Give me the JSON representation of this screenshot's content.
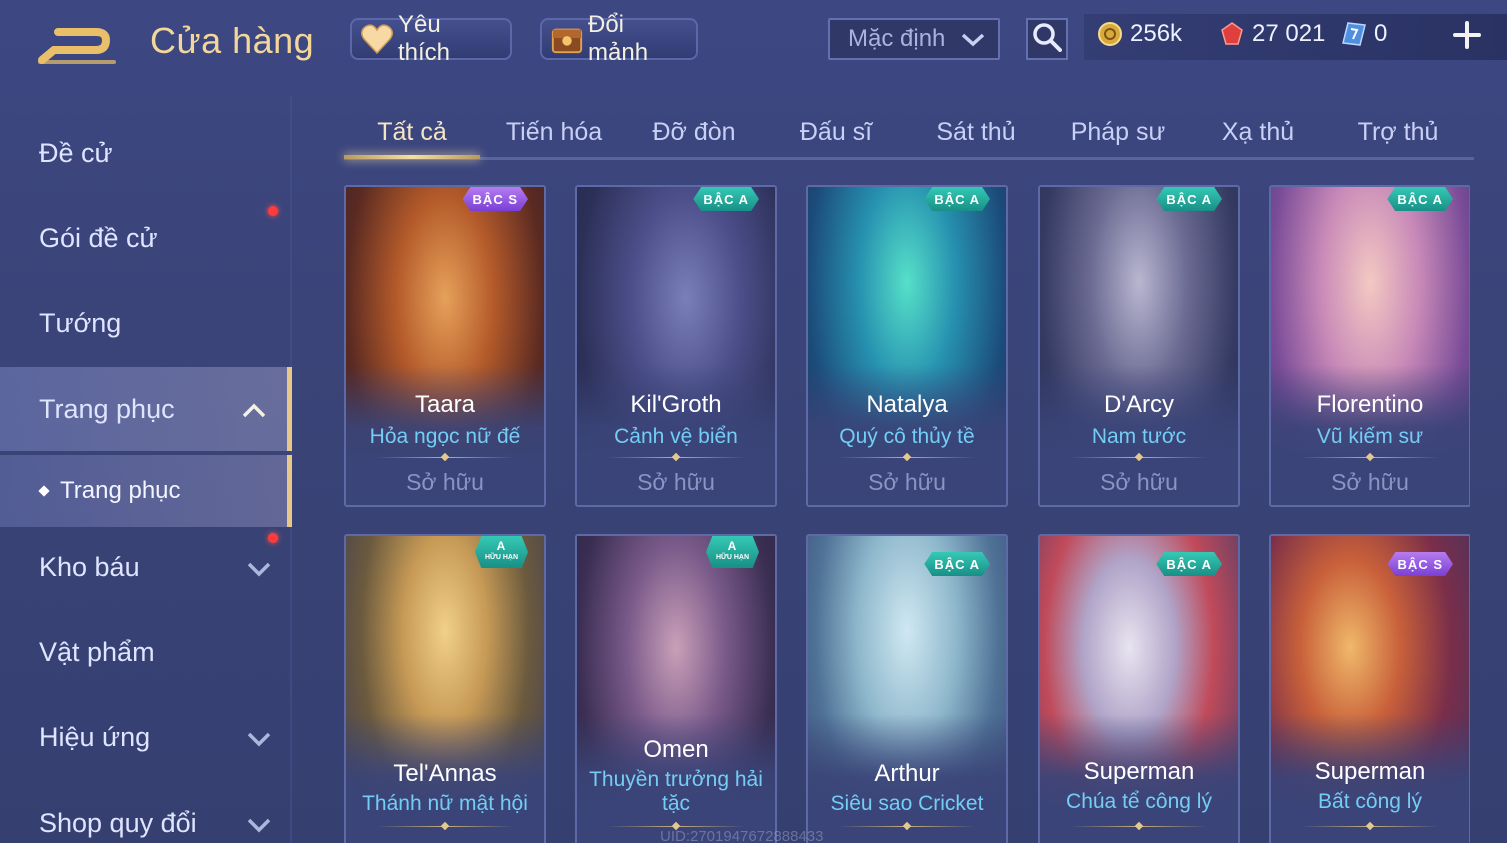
{
  "header": {
    "title": "Cửa hàng",
    "favorites_label": "Yêu thích",
    "shard_exchange_label": "Đổi mảnh",
    "sort_value": "Mặc định"
  },
  "currencies": [
    {
      "icon": "gold-coin-icon",
      "value": "256k"
    },
    {
      "icon": "ruby-gem-icon",
      "value": "27 021"
    },
    {
      "icon": "voucher-icon",
      "value": "0"
    }
  ],
  "sidebar": {
    "items": [
      {
        "label": "Đề cử"
      },
      {
        "label": "Gói đề cử"
      },
      {
        "label": "Tướng"
      },
      {
        "label": "Trang phục"
      },
      {
        "label": "Trang phục"
      },
      {
        "label": "Kho báu"
      },
      {
        "label": "Vật phẩm"
      },
      {
        "label": "Hiệu ứng"
      },
      {
        "label": "Shop quy đổi"
      }
    ]
  },
  "tabs": [
    {
      "label": "Tất cả"
    },
    {
      "label": "Tiến hóa"
    },
    {
      "label": "Đỡ đòn"
    },
    {
      "label": "Đấu sĩ"
    },
    {
      "label": "Sát thủ"
    },
    {
      "label": "Pháp sư"
    },
    {
      "label": "Xạ thủ"
    },
    {
      "label": "Trợ thủ"
    }
  ],
  "cards": [
    {
      "hero": "Taara",
      "skin": "Hỏa ngọc nữ đế",
      "status": "Sở hữu",
      "badge": "BẬC S"
    },
    {
      "hero": "Kil'Groth",
      "skin": "Cảnh vệ biển",
      "status": "Sở hữu",
      "badge": "BẬC A"
    },
    {
      "hero": "Natalya",
      "skin": "Quý cô thủy tề",
      "status": "Sở hữu",
      "badge": "BẬC A"
    },
    {
      "hero": "D'Arcy",
      "skin": "Nam tước",
      "status": "Sở hữu",
      "badge": "BẬC A"
    },
    {
      "hero": "Florentino",
      "skin": "Vũ kiếm sư",
      "status": "Sở hữu",
      "badge": "BẬC A"
    },
    {
      "hero": "Tel'Annas",
      "skin": "Thánh nữ mật hội",
      "badge": "A",
      "badge_sub": "HỮU HẠN"
    },
    {
      "hero": "Omen",
      "skin": "Thuyền trưởng hải tặc",
      "badge": "A",
      "badge_sub": "HỮU HẠN"
    },
    {
      "hero": "Arthur",
      "skin": "Siêu sao Cricket",
      "badge": "BẬC A"
    },
    {
      "hero": "Superman",
      "skin": "Chúa tể công lý",
      "badge": "BẬC A"
    },
    {
      "hero": "Superman",
      "skin": "Bất công lý",
      "badge": "BẬC S"
    }
  ],
  "uid_text": "UID:2701947672888433",
  "colors": {
    "background": "#3a4478",
    "accent_gold": "#f3d79a",
    "skin_name": "#73cdf5",
    "notification": "#ff3b3b"
  }
}
